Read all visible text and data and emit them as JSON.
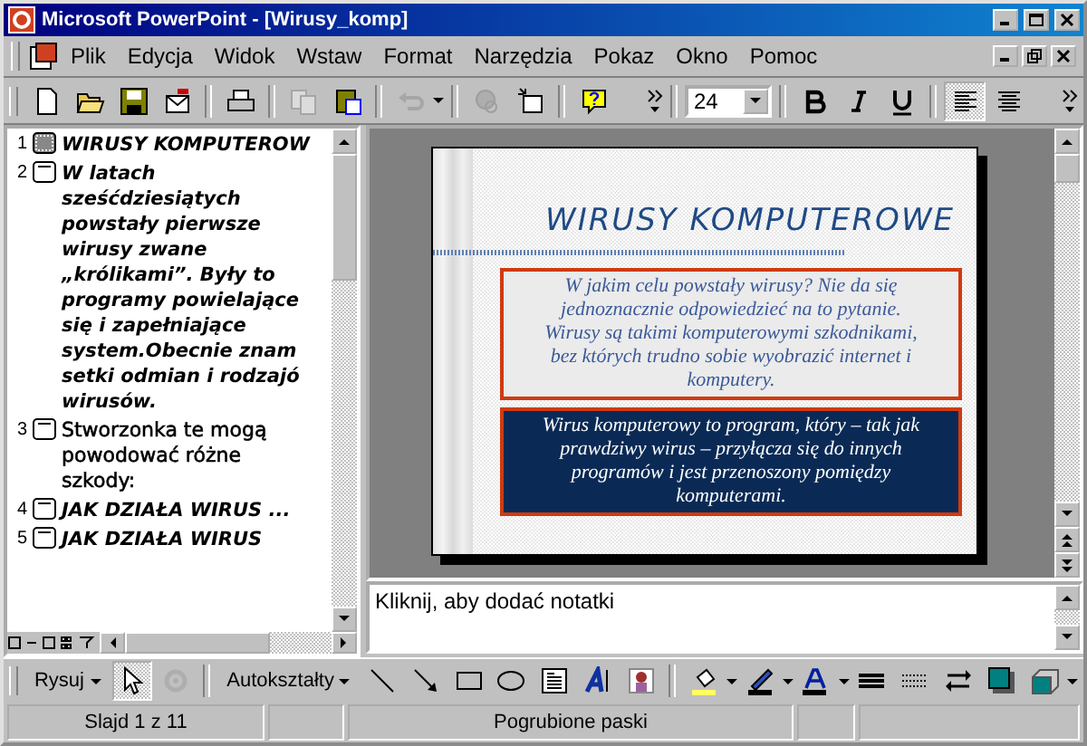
{
  "window": {
    "title": "Microsoft PowerPoint - [Wirusy_komp]"
  },
  "menu": [
    "Plik",
    "Edycja",
    "Widok",
    "Wstaw",
    "Format",
    "Narzędzia",
    "Pokaz",
    "Okno",
    "Pomoc"
  ],
  "toolbar": {
    "buttons": [
      {
        "disabled": false
      },
      {
        "disabled": false
      },
      {
        "disabled": false
      },
      {
        "disabled": false
      },
      {
        "disabled": false
      },
      {
        "disabled": true
      },
      {
        "disabled": false
      },
      {
        "disabled": true
      },
      {
        "disabled": true
      },
      {
        "disabled": false
      },
      {
        "disabled": false
      }
    ],
    "font_size": "24",
    "format_buttons": [
      {
        "selected": false
      },
      {
        "selected": false
      },
      {
        "selected": false
      },
      {
        "selected": true
      },
      {
        "selected": false
      }
    ]
  },
  "outline": [
    {
      "number": "1",
      "kind": "italic",
      "selected": true,
      "lines": [
        "WIRUSY KOMPUTEROW"
      ]
    },
    {
      "number": "2",
      "kind": "italic",
      "selected": false,
      "lines": [
        "W latach",
        "sześćdziesiątych",
        "powstały pierwsze",
        "wirusy zwane",
        "„królikami”. Były to",
        "programy powielające",
        "się i zapełniające",
        "system.Obecnie znam",
        "setki odmian i rodzajó",
        "wirusów."
      ]
    },
    {
      "number": "3",
      "kind": "upright",
      "selected": false,
      "lines": [
        "Stworzonka te mogą",
        "powodować różne",
        "szkody:"
      ]
    },
    {
      "number": "4",
      "kind": "italic",
      "selected": false,
      "lines": [
        "JAK DZIAŁA WIRUS ..."
      ]
    },
    {
      "number": "5",
      "kind": "italic",
      "selected": false,
      "lines": [
        "JAK DZIAŁA WIRUS"
      ]
    }
  ],
  "slide": {
    "title": "WIRUSY KOMPUTEROWE",
    "question_box": "W jakim celu powstały wirusy? Nie da się jednoznacznie odpowiedzieć na to pytanie. Wirusy są takimi komputerowymi szkodnikami, bez których trudno sobie wyobrazić internet i komputery.",
    "definition_box": "Wirus komputerowy to program, który – tak jak prawdziwy wirus – przyłącza się do innych programów i jest przenoszony pomiędzy komputerami."
  },
  "notes": {
    "text": "Kliknij, aby dodać notatki"
  },
  "drawing_toolbar": {
    "draw_menu": "Rysuj",
    "autoshapes_menu": "Autokształty",
    "buttons": [
      {
        "selected": true,
        "disabled": false
      },
      {
        "selected": false,
        "disabled": true
      },
      {
        "selected": false,
        "disabled": false
      },
      {
        "selected": false,
        "disabled": false
      },
      {
        "selected": false,
        "disabled": false
      },
      {
        "selected": false,
        "disabled": false
      },
      {
        "selected": false,
        "disabled": false
      },
      {
        "selected": false,
        "disabled": false
      },
      {
        "selected": false,
        "disabled": false
      },
      {
        "selected": false,
        "disabled": false
      },
      {
        "selected": false,
        "disabled": false
      },
      {
        "selected": false,
        "disabled": false
      },
      {
        "selected": false,
        "disabled": false
      },
      {
        "selected": false,
        "disabled": false
      },
      {
        "selected": false,
        "disabled": false
      },
      {
        "selected": false,
        "disabled": false
      },
      {
        "selected": false,
        "disabled": false
      }
    ]
  },
  "status_bar": {
    "slide": "Slajd 1 z 11",
    "design": "Pogrubione paski"
  }
}
